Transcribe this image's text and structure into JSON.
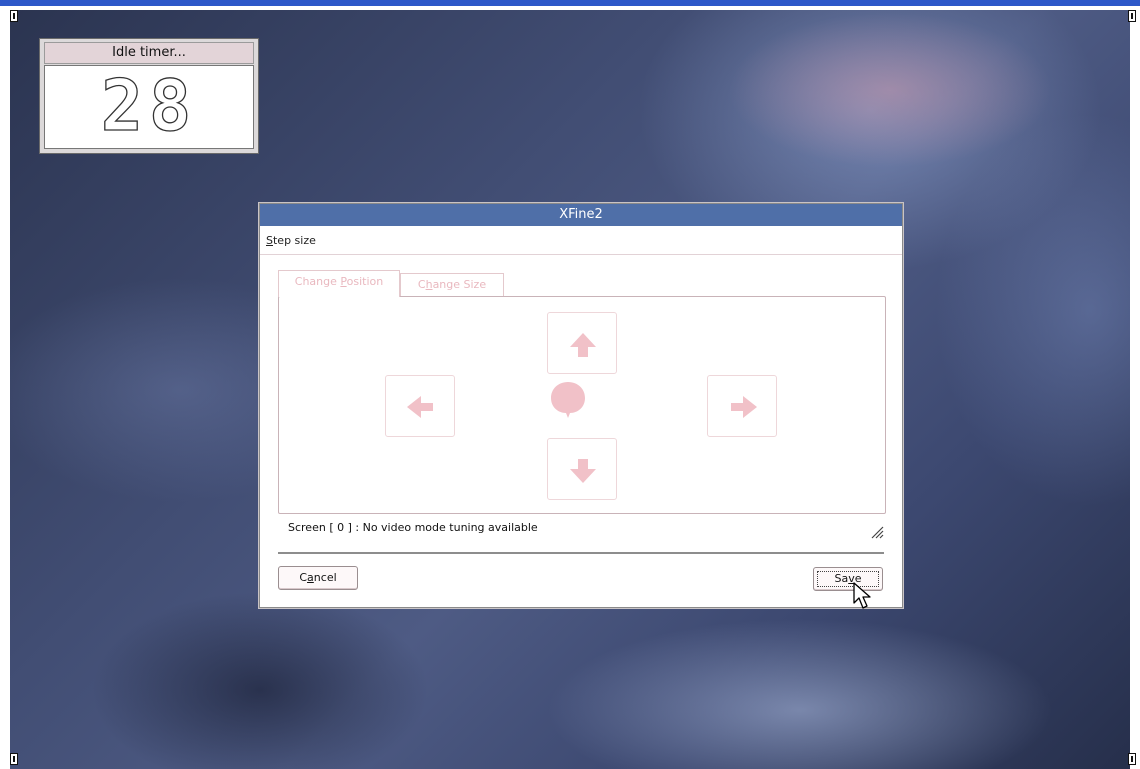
{
  "idle_timer": {
    "title": "Idle timer...",
    "value": "28"
  },
  "dialog": {
    "title": "XFine2",
    "menu": {
      "step_size_label": "Step size",
      "step_size_mnemonic": "S",
      "step_size_rest": "tep size"
    },
    "tabs": [
      {
        "label": "Change Position",
        "mnemonic_before": "Change ",
        "mnemonic": "P",
        "mnemonic_after": "osition",
        "active": true
      },
      {
        "label": "Change Size",
        "mnemonic_before": "C",
        "mnemonic": "h",
        "mnemonic_after": "ange Size",
        "active": false
      }
    ],
    "controls": {
      "up_icon": "arrow-up-icon",
      "down_icon": "arrow-down-icon",
      "left_icon": "arrow-left-icon",
      "right_icon": "arrow-right-icon",
      "center_icon": "center-dot-icon"
    },
    "status": "Screen [ 0 ] : No video mode tuning available",
    "buttons": {
      "cancel": {
        "label": "Cancel",
        "before": "C",
        "mnemonic": "a",
        "after": "ncel"
      },
      "save": {
        "label": "Save",
        "before": "Sa",
        "mnemonic": "v",
        "after": "e"
      }
    }
  },
  "colors": {
    "title_bar": "#4f6fa8",
    "disabled_text": "#e9b8bf",
    "disabled_icon": "#f1c1c8",
    "top_bar": "#2d58c9"
  }
}
